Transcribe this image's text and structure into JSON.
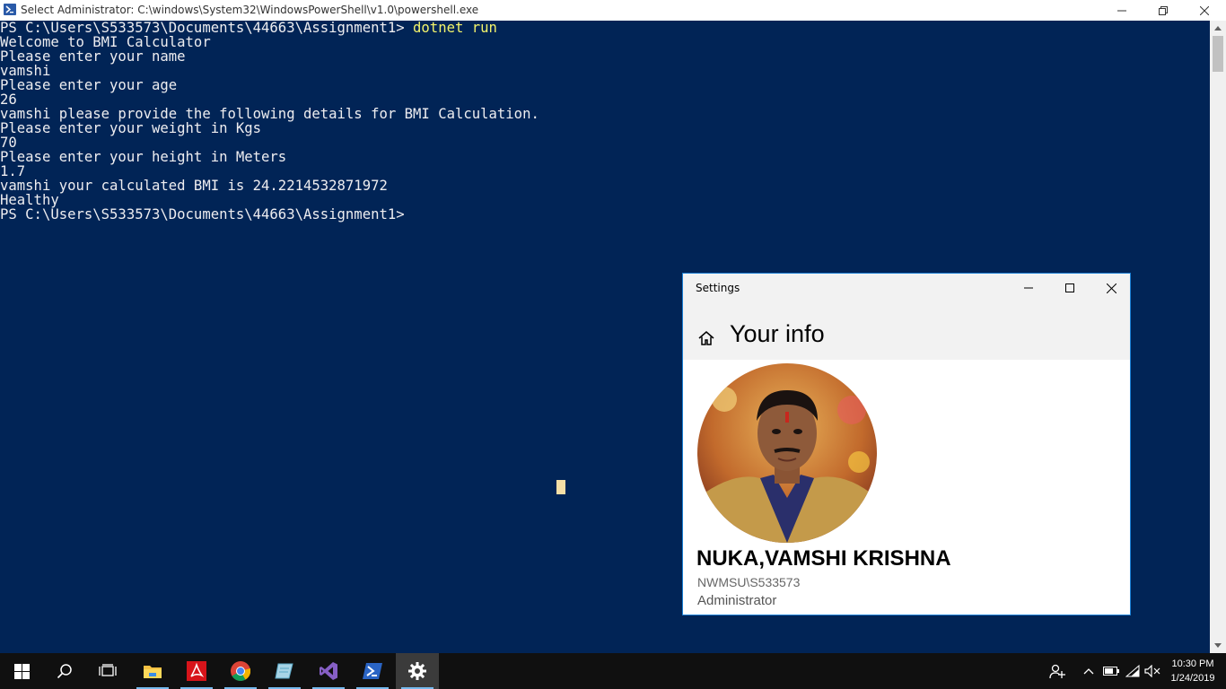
{
  "powershell": {
    "title": "Select Administrator: C:\\windows\\System32\\WindowsPowerShell\\v1.0\\powershell.exe",
    "prompt": "PS C:\\Users\\S533573\\Documents\\44663\\Assignment1> ",
    "command": "dotnet run",
    "output": [
      "Welcome to BMI Calculator",
      "Please enter your name",
      "vamshi",
      "Please enter your age",
      "26",
      "vamshi please provide the following details for BMI Calculation.",
      "Please enter your weight in Kgs",
      "70",
      "Please enter your height in Meters",
      "1.7",
      "vamshi your calculated BMI is 24.2214532871972",
      "Healthy"
    ],
    "final_prompt": "PS C:\\Users\\S533573\\Documents\\44663\\Assignment1>",
    "colors": {
      "background": "#012456",
      "text": "#eeedf0",
      "command": "#f3f36b"
    }
  },
  "settings": {
    "title": "Settings",
    "page_title": "Your info",
    "user_name": "NUKA,VAMSHI KRISHNA",
    "account": "NWMSU\\S533573",
    "role": "Administrator"
  },
  "taskbar": {
    "icons": [
      "start-icon",
      "search-icon",
      "task-view-icon",
      "file-explorer-icon",
      "acrobat-icon",
      "chrome-icon",
      "notepad-icon",
      "visual-studio-icon",
      "powershell-icon",
      "settings-icon"
    ],
    "active": "settings-icon",
    "time": "10:30 PM",
    "date": "1/24/2019"
  }
}
